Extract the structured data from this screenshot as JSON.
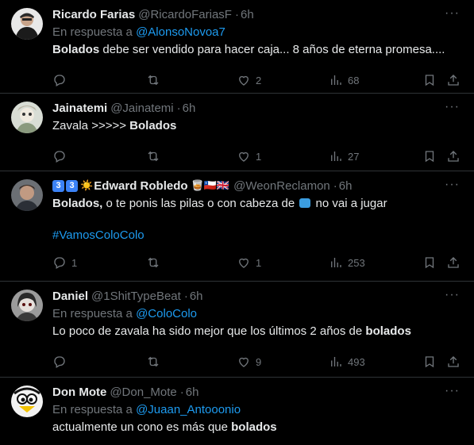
{
  "tweets": [
    {
      "name": "Ricardo Farias",
      "handle": "@RicardoFariasF",
      "time": "6h",
      "reply_prefix": "En respuesta a",
      "reply_to": "@AlonsoNovoa7",
      "text_bold": "Bolados",
      "text_rest": " debe ser vendido para hacer caja... 8 años de eterna promesa....",
      "replies": "",
      "retweets": "",
      "likes": "2",
      "views": "68"
    },
    {
      "name": "Jainatemi",
      "handle": "@Jainatemi",
      "time": "6h",
      "text_pre": "Zavala >>>>> ",
      "text_bold": "Bolados",
      "replies": "",
      "retweets": "",
      "likes": "1",
      "views": "27"
    },
    {
      "name_badges": [
        "3",
        "3"
      ],
      "name_sun": "☀️",
      "name": "Edward Robledo",
      "name_trailing": "🥃🇨🇱🇬🇧",
      "handle": "@WeonReclamon",
      "time": "6h",
      "text_bold": "Bolados,",
      "text_mid": " o te ponis las pilas o con cabeza de ",
      "text_end": " no vai a jugar",
      "hashtag": "#VamosColoColo",
      "replies": "1",
      "retweets": "",
      "likes": "1",
      "views": "253"
    },
    {
      "name": "Daniel",
      "handle": "@1ShitTypeBeat",
      "time": "6h",
      "reply_prefix": "En respuesta a",
      "reply_to": "@ColoColo",
      "text_pre": "Lo poco de zavala ha sido mejor que los últimos 2 años de ",
      "text_bold": "bolados",
      "replies": "",
      "retweets": "",
      "likes": "9",
      "views": "493"
    },
    {
      "name": "Don Mote",
      "handle": "@Don_Mote",
      "time": "6h",
      "reply_prefix": "En respuesta a",
      "reply_to": "@Juaan_Antooonio",
      "text_pre": "actualmente un cono es más que ",
      "text_bold": "bolados"
    }
  ],
  "ui": {
    "dot": "·",
    "more": "···"
  },
  "colors": {
    "background": "#000000",
    "text": "#e7e9ea",
    "muted": "#71767b",
    "link": "#1d9bf0",
    "border": "#2f3336"
  },
  "icons": [
    "reply-icon",
    "retweet-icon",
    "like-icon",
    "views-icon",
    "bookmark-icon",
    "share-icon",
    "more-icon"
  ]
}
